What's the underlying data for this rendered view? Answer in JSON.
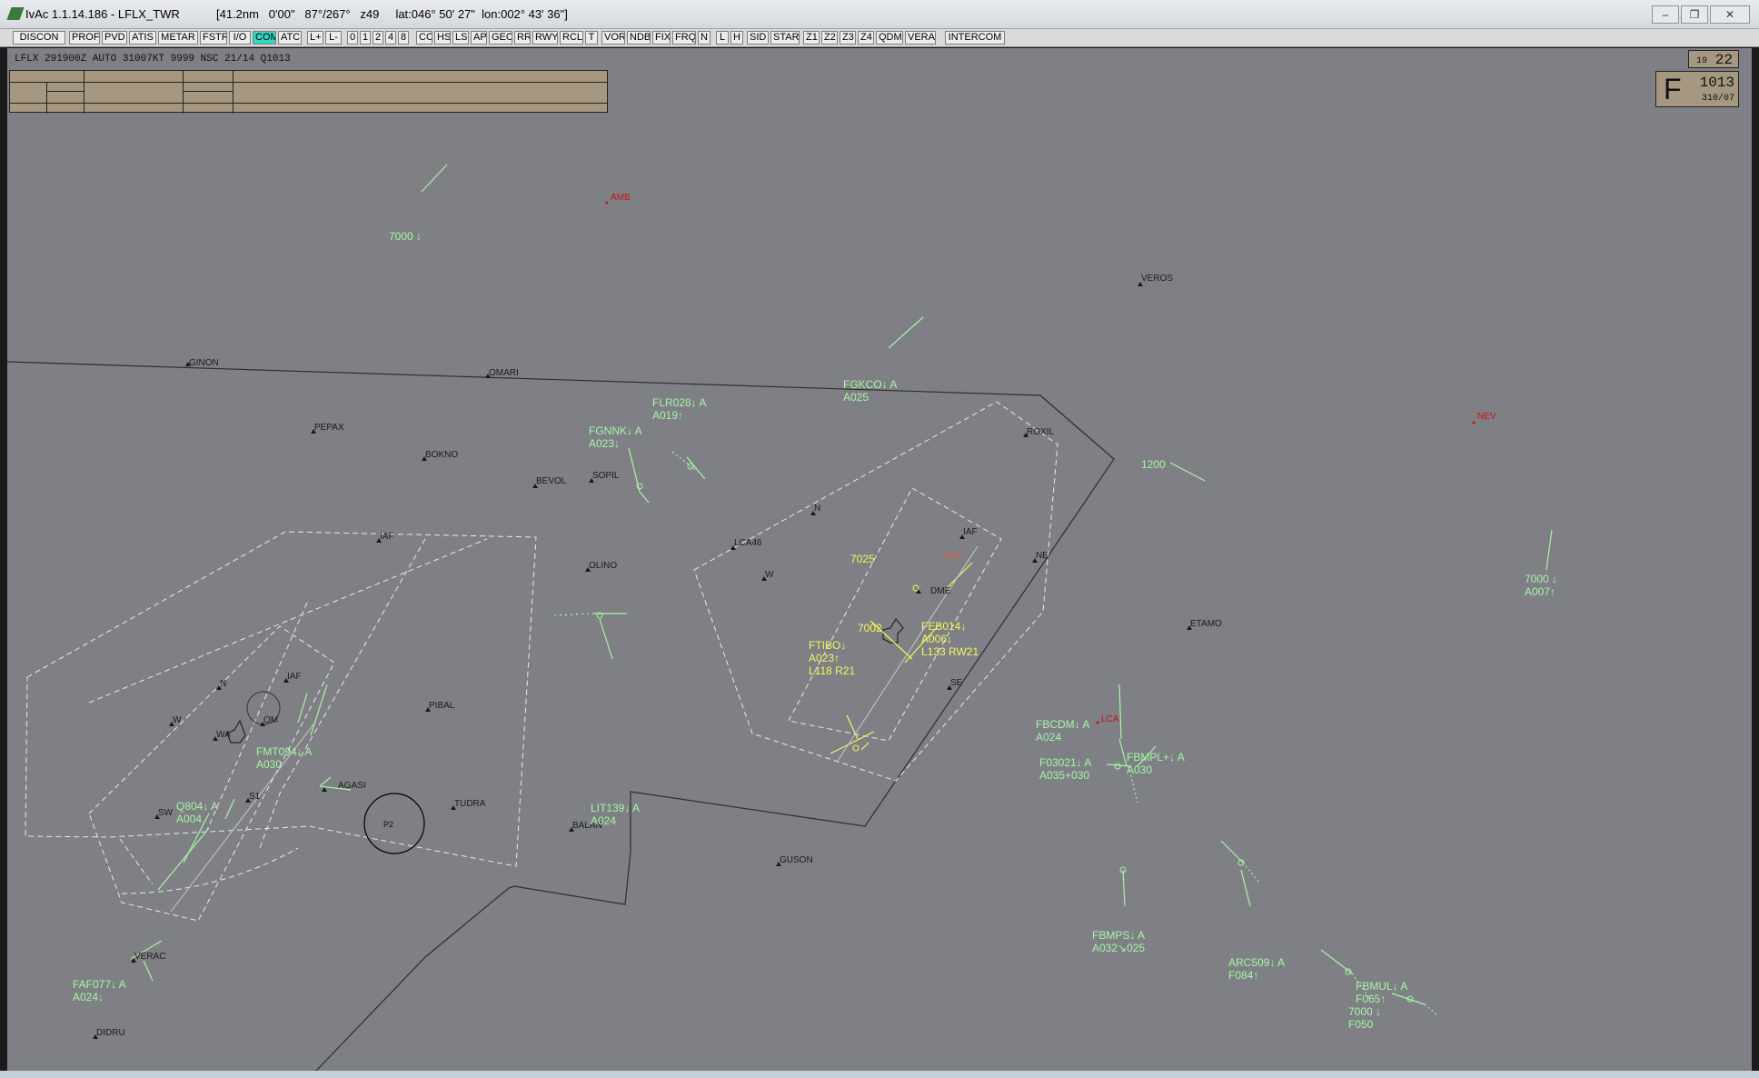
{
  "window": {
    "app": "IvAc 1.1.14.186 - LFLX_TWR",
    "status": "[41.2nm   0'00\"   87°/267°   z49     lat:046° 50' 27\"  lon:002° 43' 36\"]",
    "controls": [
      "–",
      "❐",
      "✕"
    ]
  },
  "toolbar": [
    {
      "label": "DISCON"
    },
    {
      "label": "PROF"
    },
    {
      "label": "PVD"
    },
    {
      "label": "ATIS"
    },
    {
      "label": "METAR"
    },
    {
      "label": "FSTR"
    },
    {
      "label": "I/O"
    },
    {
      "label": "COM",
      "active": true
    },
    {
      "label": "ATC"
    },
    {
      "label": "L+"
    },
    {
      "label": "L-"
    },
    {
      "label": "0"
    },
    {
      "label": "1"
    },
    {
      "label": "2"
    },
    {
      "label": "4"
    },
    {
      "label": "8"
    },
    {
      "label": "CC"
    },
    {
      "label": "HS"
    },
    {
      "label": "LS"
    },
    {
      "label": "AP"
    },
    {
      "label": "GEO"
    },
    {
      "label": "RR"
    },
    {
      "label": "RWY"
    },
    {
      "label": "RCL"
    },
    {
      "label": "T"
    },
    {
      "label": "VOR"
    },
    {
      "label": "NDB"
    },
    {
      "label": "FIX"
    },
    {
      "label": "FRQ"
    },
    {
      "label": "N"
    },
    {
      "label": "L"
    },
    {
      "label": "H"
    },
    {
      "label": "SID"
    },
    {
      "label": "STAR"
    },
    {
      "label": "Z1"
    },
    {
      "label": "Z2"
    },
    {
      "label": "Z3"
    },
    {
      "label": "Z4"
    },
    {
      "label": "QDM"
    },
    {
      "label": "VERA"
    },
    {
      "label": "INTERCOM"
    }
  ],
  "metar": "LFLX 291900Z AUTO 31007KT 9999 NSC 21/14 Q1013",
  "clock": {
    "hour": "19",
    "minute": "22"
  },
  "qnh": {
    "letter": "F",
    "value": "1013",
    "wind": "310/07"
  },
  "colors": {
    "scope": "#7f8085",
    "aircraft": "#a5f5a5",
    "assumed": "#f5f55a",
    "alert": "#cc1111",
    "fix": "#1a1a1a",
    "highlight": "#33d6c2"
  },
  "fixes": [
    {
      "name": "GINON",
      "color": "dark"
    },
    {
      "name": "OMARI",
      "color": "dark"
    },
    {
      "name": "PEPAX",
      "color": "dark"
    },
    {
      "name": "BOKNO",
      "color": "dark"
    },
    {
      "name": "BEVOL",
      "color": "dark"
    },
    {
      "name": "SOPIL",
      "color": "dark"
    },
    {
      "name": "IAF",
      "color": "dark"
    },
    {
      "name": "OLINO",
      "color": "dark"
    },
    {
      "name": "PIBAL",
      "color": "dark"
    },
    {
      "name": "TUDRA",
      "color": "dark"
    },
    {
      "name": "AGASI",
      "color": "dark"
    },
    {
      "name": "BALAN",
      "color": "dark"
    },
    {
      "name": "GUSON",
      "color": "dark"
    },
    {
      "name": "VERAC",
      "color": "dark"
    },
    {
      "name": "DIDRU",
      "color": "dark"
    },
    {
      "name": "VEROS",
      "color": "dark"
    },
    {
      "name": "ROXIL",
      "color": "dark"
    },
    {
      "name": "ETAMO",
      "color": "dark"
    },
    {
      "name": "LCA46",
      "color": "dark"
    },
    {
      "name": "N",
      "color": "dark"
    },
    {
      "name": "W",
      "color": "dark"
    },
    {
      "name": "NE",
      "color": "dark"
    },
    {
      "name": "SE",
      "color": "dark"
    },
    {
      "name": "DME",
      "color": "dark"
    },
    {
      "name": "IAF",
      "color": "dark"
    },
    {
      "name": "N",
      "color": "dark"
    },
    {
      "name": "W",
      "color": "dark"
    },
    {
      "name": "WA",
      "color": "dark"
    },
    {
      "name": "OM",
      "color": "dark"
    },
    {
      "name": "S1",
      "color": "dark"
    },
    {
      "name": "SW",
      "color": "dark"
    },
    {
      "name": "IAF",
      "color": "dark"
    },
    {
      "name": "AMB",
      "color": "red"
    },
    {
      "name": "NEV",
      "color": "red"
    },
    {
      "name": "LCA",
      "color": "red"
    },
    {
      "name": "CTR",
      "color": "orange"
    }
  ],
  "zones": [
    {
      "name": "P2"
    }
  ],
  "aircraft": [
    {
      "line1": "7000 ↓",
      "line2": "",
      "color": "green"
    },
    {
      "line1": "FGKCO↓ A",
      "line2": "A025",
      "color": "green"
    },
    {
      "line1": "FLR028↓ A",
      "line2": "A019↑",
      "color": "green"
    },
    {
      "line1": "FGNNK↓ A",
      "line2": "A023↓",
      "color": "green"
    },
    {
      "line1": "1200",
      "line2": "",
      "color": "green"
    },
    {
      "line1": "7000 ↓",
      "line2": "A007↑",
      "color": "green"
    },
    {
      "line1": "7025",
      "line2": "",
      "color": "yellow"
    },
    {
      "line1": "7002",
      "line2": "",
      "color": "yellow"
    },
    {
      "line1": "FTIBO↓",
      "line2": "A023↑",
      "line3": "L118 R21",
      "color": "yellow"
    },
    {
      "line1": "FEB014↓",
      "line2": "A006↓",
      "line3": "L133 RW21",
      "color": "yellow"
    },
    {
      "line1": "FBCDM↓ A",
      "line2": "A024",
      "color": "green"
    },
    {
      "line1": "F03021↓ A",
      "line2": "A035+030",
      "color": "green"
    },
    {
      "line1": "FBMPL+↓ A",
      "line2": "A030",
      "color": "green"
    },
    {
      "line1": "LIT139↓ A",
      "line2": "A024",
      "color": "green"
    },
    {
      "line1": "FMT094↓ A",
      "line2": "A030",
      "color": "green"
    },
    {
      "line1": "Q804↓ A",
      "line2": "A004",
      "color": "green"
    },
    {
      "line1": "FAF077↓ A",
      "line2": "A024↓",
      "color": "green"
    },
    {
      "line1": "FBMPS↓ A",
      "line2": "A032↘025",
      "color": "green"
    },
    {
      "line1": "ARC509↓ A",
      "line2": "F084↑",
      "color": "green"
    },
    {
      "line1": "FBMUL↓ A",
      "line2": "F065↑",
      "color": "green"
    },
    {
      "line1": "7000 ↓",
      "line2": "F050",
      "color": "green"
    }
  ]
}
